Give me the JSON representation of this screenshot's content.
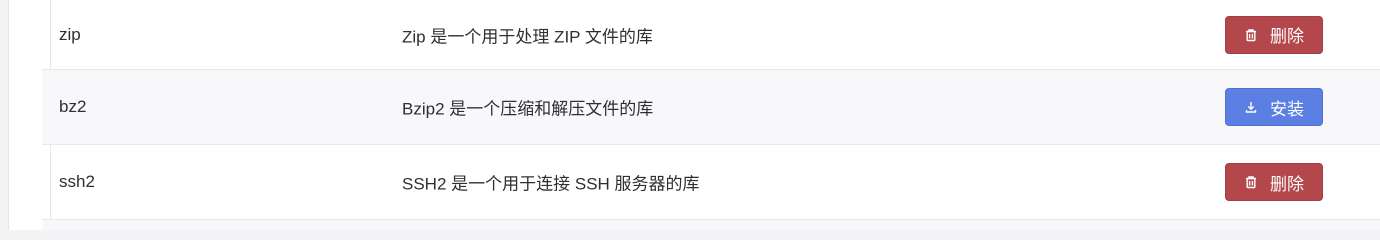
{
  "table": {
    "rows": [
      {
        "name": "zip",
        "description": "Zip 是一个用于处理 ZIP 文件的库",
        "action": {
          "label": "删除",
          "type": "delete",
          "icon": "trash-icon",
          "color": "#b4474c"
        }
      },
      {
        "name": "bz2",
        "description": "Bzip2 是一个压缩和解压文件的库",
        "action": {
          "label": "安装",
          "type": "install",
          "icon": "download-icon",
          "color": "#5b7fe3"
        }
      },
      {
        "name": "ssh2",
        "description": "SSH2 是一个用于连接 SSH 服务器的库",
        "action": {
          "label": "删除",
          "type": "delete",
          "icon": "trash-icon",
          "color": "#b4474c"
        }
      }
    ]
  }
}
